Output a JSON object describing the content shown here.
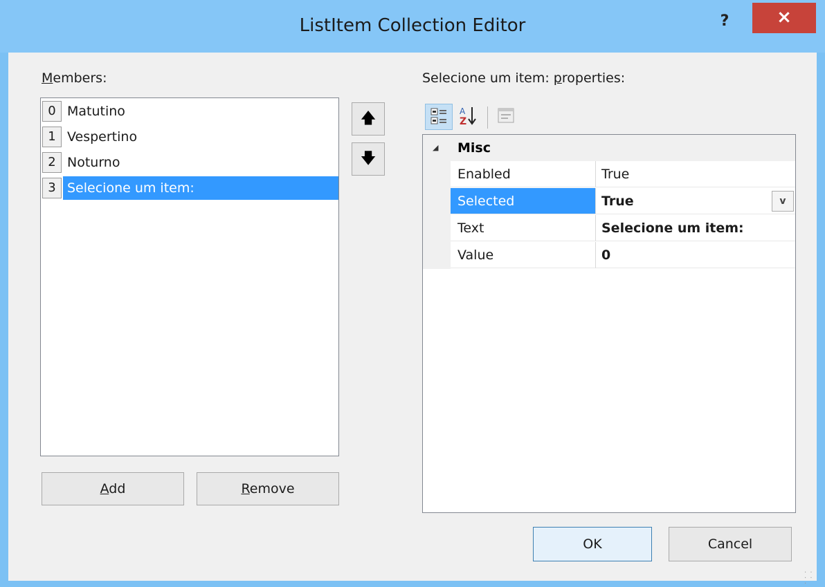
{
  "window": {
    "title": "ListItem Collection Editor",
    "help_label": "?",
    "close_label": "×"
  },
  "members": {
    "label_underline": "M",
    "label_rest": "embers:",
    "items": [
      {
        "index": "0",
        "text": "Matutino"
      },
      {
        "index": "1",
        "text": "Vespertino"
      },
      {
        "index": "2",
        "text": "Noturno"
      },
      {
        "index": "3",
        "text": "Selecione um item:"
      }
    ],
    "selected_index": 3
  },
  "buttons": {
    "move_up": "🡅",
    "move_down": "🡇",
    "add_underline": "A",
    "add_rest": "dd",
    "remove_underline": "R",
    "remove_rest": "emove",
    "ok": "OK",
    "cancel": "Cancel"
  },
  "properties": {
    "label_prefix": "Selecione um item: ",
    "label_underline": "p",
    "label_rest": "roperties:",
    "category": "Misc",
    "collapse_glyph": "◢",
    "rows": [
      {
        "name": "Enabled",
        "value": "True"
      },
      {
        "name": "Selected",
        "value": "True"
      },
      {
        "name": "Text",
        "value": "Selecione um item:"
      },
      {
        "name": "Value",
        "value": "0"
      }
    ],
    "dropdown_glyph": "v"
  },
  "toolbar": {
    "icons": [
      "categorized-icon",
      "alphabetical-icon",
      "property-pages-icon"
    ]
  },
  "colors": {
    "selection": "#3399ff",
    "title_bar": "#85c6f7",
    "close": "#c7433a"
  }
}
